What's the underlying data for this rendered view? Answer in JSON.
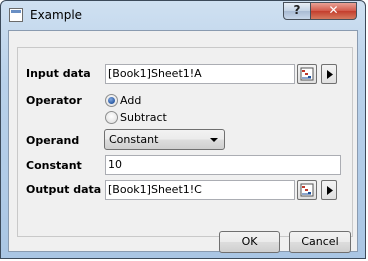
{
  "window": {
    "title": "Example",
    "help_label": "?",
    "close_label": "✕"
  },
  "form": {
    "input_data": {
      "label": "Input data",
      "value": "[Book1]Sheet1!A"
    },
    "operator": {
      "label": "Operator",
      "options": [
        {
          "label": "Add",
          "checked": true
        },
        {
          "label": "Subtract",
          "checked": false
        }
      ]
    },
    "operand": {
      "label": "Operand",
      "selected": "Constant"
    },
    "constant": {
      "label": "Constant",
      "value": "10"
    },
    "output_data": {
      "label": "Output data",
      "value": "[Book1]Sheet1!C"
    }
  },
  "buttons": {
    "ok": "OK",
    "cancel": "Cancel"
  }
}
